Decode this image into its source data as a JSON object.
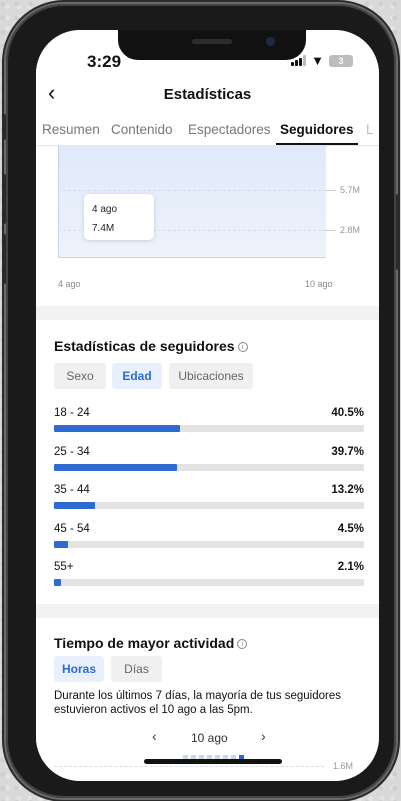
{
  "status": {
    "time": "3:29",
    "battery": "3"
  },
  "header": {
    "title": "Estadísticas"
  },
  "tabs": [
    "Resumen",
    "Contenido",
    "Espectadores",
    "Seguidores",
    "L"
  ],
  "active_tab": "Seguidores",
  "chart_data": {
    "type": "area",
    "x": [
      "4 ago",
      "10 ago"
    ],
    "y_ticks": [
      "5.7M",
      "2.8M"
    ],
    "tooltip": {
      "date": "4 ago",
      "value": "7.4M"
    }
  },
  "follower_stats": {
    "title": "Estadísticas de seguidores",
    "filters": [
      "Sexo",
      "Edad",
      "Ubicaciones"
    ],
    "active_filter": "Edad",
    "ages": [
      {
        "label": "18 - 24",
        "pct": "40.5%",
        "value": 40.5
      },
      {
        "label": "25 - 34",
        "pct": "39.7%",
        "value": 39.7
      },
      {
        "label": "35 - 44",
        "pct": "13.2%",
        "value": 13.2
      },
      {
        "label": "45 - 54",
        "pct": "4.5%",
        "value": 4.5
      },
      {
        "label": "55+",
        "pct": "2.1%",
        "value": 2.1
      }
    ]
  },
  "activity": {
    "title": "Tiempo de mayor actividad",
    "filters": [
      "Horas",
      "Días"
    ],
    "active_filter": "Horas",
    "description": "Durante los últimos 7 días, la mayoría de tus seguidores estuvieron activos el 10 ago a las 5pm.",
    "date": "10 ago",
    "y_tick": "1.6M"
  },
  "colors": {
    "accent": "#2e6bd1",
    "bar_track": "#e3e3e3",
    "chip_active_bg": "#e9f0fd"
  }
}
